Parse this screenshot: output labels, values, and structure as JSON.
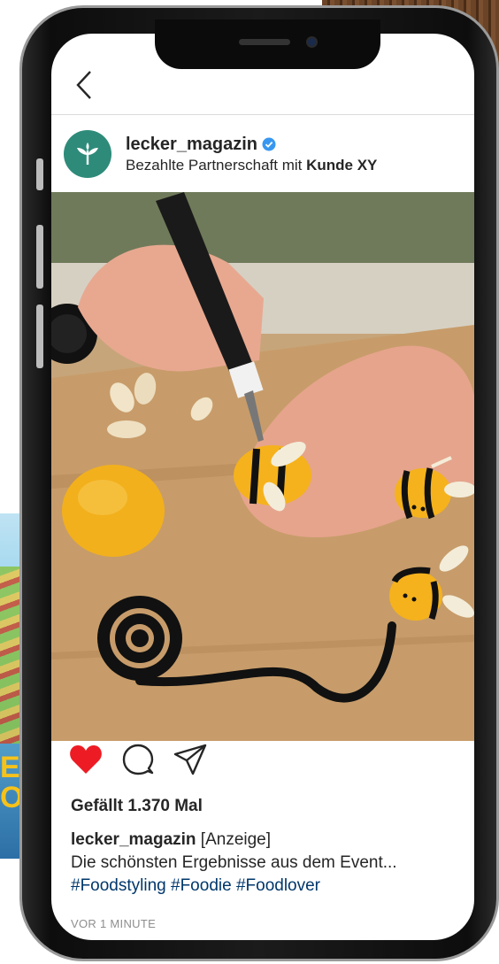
{
  "colors": {
    "accent_teal": "#2e8b7a",
    "verified_blue": "#3897f0",
    "heart_red": "#ed4956",
    "hashtag_blue": "#00376b",
    "text": "#262626",
    "muted": "#8e8e8e"
  },
  "icons": {
    "back": "chevron-left-icon",
    "avatar": "leaf-logo-icon",
    "verified": "verified-badge-icon",
    "like": "heart-icon",
    "comment": "comment-icon",
    "share": "send-icon"
  },
  "post": {
    "username": "lecker_magazin",
    "partnership_prefix": "Bezahlte Partnerschaft mit ",
    "partner_name": "Kunde XY",
    "likes_text": "Gefällt 1.370 Mal",
    "caption_username": "lecker_magazin",
    "caption_tag": " [Anzeige]",
    "caption_excerpt": "Die schönsten Ergebnisse aus dem Event...",
    "hashtags": "#Foodstyling #Foodie #Foodlover",
    "time": "VOR 1 MINUTE"
  },
  "magazine": {
    "big_text": "E, OS"
  }
}
